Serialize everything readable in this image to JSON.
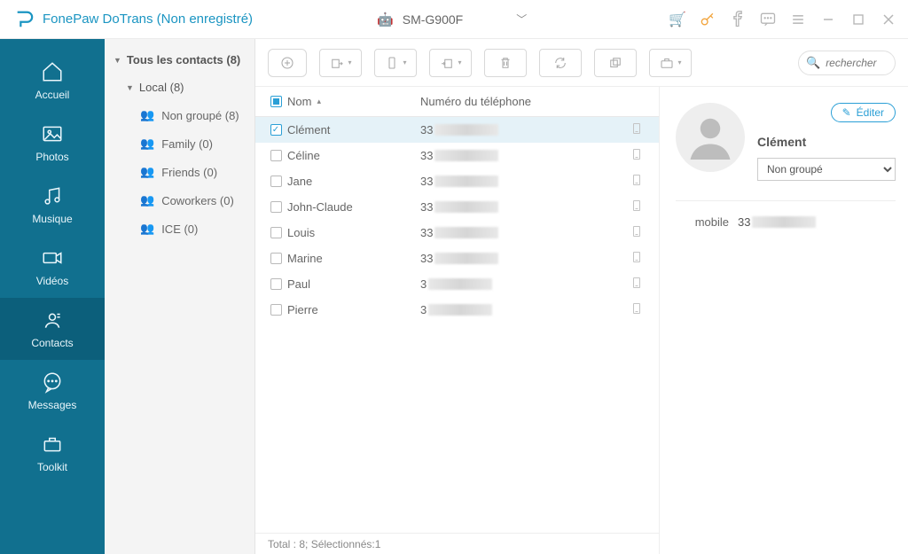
{
  "app": {
    "title": "FonePaw DoTrans (Non enregistré)"
  },
  "device": {
    "name": "SM-G900F"
  },
  "nav": {
    "home": "Accueil",
    "photos": "Photos",
    "music": "Musique",
    "videos": "Vidéos",
    "contacts": "Contacts",
    "messages": "Messages",
    "toolkit": "Toolkit"
  },
  "tree": {
    "all": "Tous les contacts  (8)",
    "local": "Local  (8)",
    "groups": [
      {
        "name": "Non groupé  (8)"
      },
      {
        "name": "Family  (0)"
      },
      {
        "name": "Friends  (0)"
      },
      {
        "name": "Coworkers  (0)"
      },
      {
        "name": "ICE  (0)"
      }
    ]
  },
  "search": {
    "placeholder": "rechercher"
  },
  "columns": {
    "name": "Nom",
    "phone": "Numéro du téléphone"
  },
  "rows": [
    {
      "name": "Clément",
      "phone_prefix": "33",
      "selected": true
    },
    {
      "name": "Céline",
      "phone_prefix": "33",
      "selected": false
    },
    {
      "name": "Jane",
      "phone_prefix": "33",
      "selected": false
    },
    {
      "name": "John-Claude",
      "phone_prefix": "33",
      "selected": false
    },
    {
      "name": "Louis",
      "phone_prefix": "33",
      "selected": false
    },
    {
      "name": "Marine",
      "phone_prefix": "33",
      "selected": false
    },
    {
      "name": "Paul",
      "phone_prefix": "3",
      "selected": false
    },
    {
      "name": "Pierre",
      "phone_prefix": "3",
      "selected": false
    }
  ],
  "status": {
    "text": "Total : 8; Sélectionnés:1"
  },
  "detail": {
    "edit_label": "Éditer",
    "name": "Clément",
    "group": "Non groupé",
    "mobile_label": "mobile",
    "mobile_prefix": "33"
  }
}
